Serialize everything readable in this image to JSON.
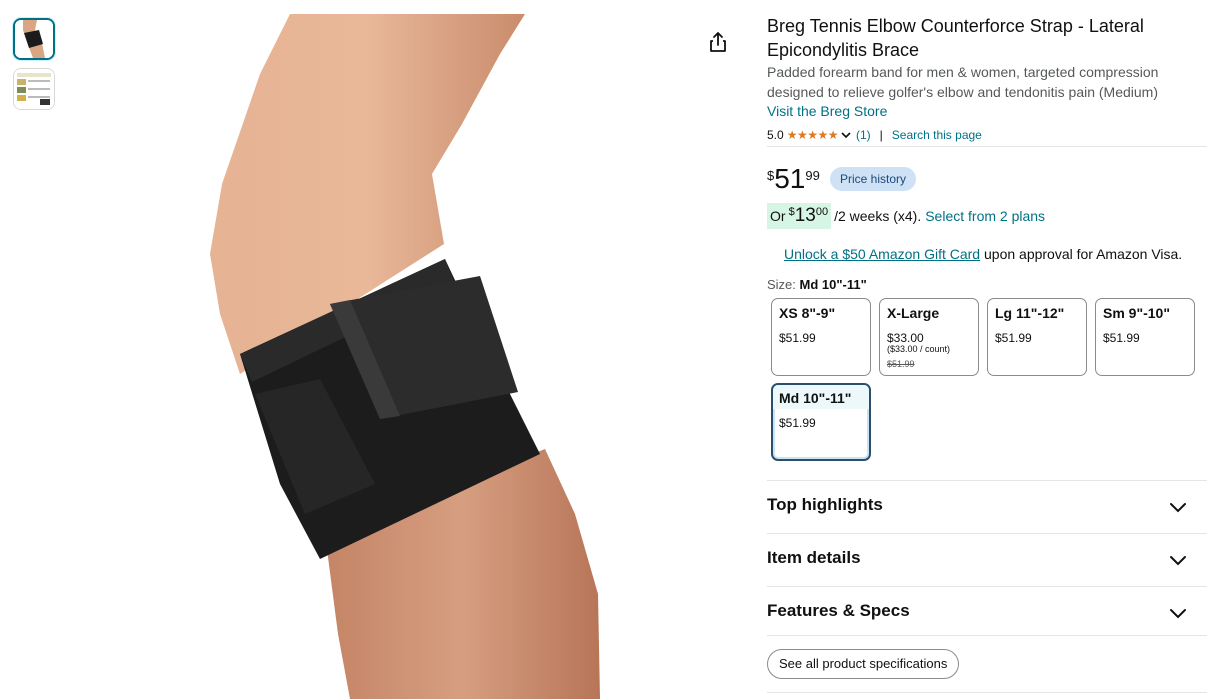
{
  "product": {
    "title": "Breg Tennis Elbow Counterforce Strap - Lateral Epicondylitis Brace",
    "subtitle": "Padded forearm band for men & women, targeted compression designed to relieve golfer's elbow and tendonitis pain (Medium)",
    "store_link": "Visit the Breg Store"
  },
  "rating": {
    "value": "5.0",
    "stars": "★★★★★",
    "count": "(1)",
    "divider": "|",
    "search_label": "Search this page"
  },
  "price": {
    "symbol": "$",
    "whole": "51",
    "fraction": "99",
    "history_label": "Price history"
  },
  "installment": {
    "or": "Or",
    "symbol": "$",
    "whole": "13",
    "fraction": "00",
    "text": "/2 weeks (x4).",
    "link": "Select from 2 plans"
  },
  "giftcard": {
    "link": "Unlock a $50 Amazon Gift Card",
    "text": " upon approval for Amazon Visa."
  },
  "size": {
    "label": "Size: ",
    "selected": "Md 10\"-11\"",
    "options": [
      {
        "name": "XS 8\"-9\"",
        "price": "$51.99"
      },
      {
        "name": "X-Large",
        "price": "$33.00",
        "unit": "($33.00 / count)",
        "strike": "$51.99"
      },
      {
        "name": "Lg 11\"-12\"",
        "price": "$51.99"
      },
      {
        "name": "Sm 9\"-10\"",
        "price": "$51.99"
      },
      {
        "name": "Md 10\"-11\"",
        "price": "$51.99"
      }
    ]
  },
  "sections": {
    "highlights": "Top highlights",
    "details": "Item details",
    "features": "Features & Specs"
  },
  "specs_button": "See all product specifications",
  "icons": {
    "share": "share-icon",
    "chevron": "chevron-down-icon"
  },
  "colors": {
    "link": "#007185",
    "star": "#de7921",
    "installment_bg": "#d7f5e4",
    "price_history_bg": "#cfe1f5",
    "selected_border": "#2b4e6d"
  }
}
